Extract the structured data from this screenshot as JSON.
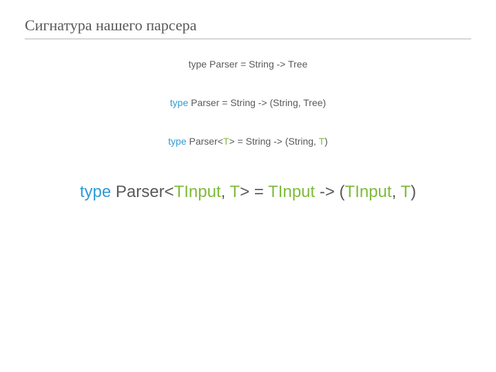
{
  "title": "Сигнатура нашего парсера",
  "line1": {
    "text": "type Parser = String -> Tree"
  },
  "line2": {
    "kw": "type",
    "rest": " Parser = String -> (String, Tree)"
  },
  "line3": {
    "kw": "type",
    "p1": " Parser<",
    "tp1": "T",
    "p2": "> = String -> (String, ",
    "tp2": "T",
    "p3": ")"
  },
  "line4": {
    "kw": "type",
    "p1": " Parser<",
    "tp1": "TInput",
    "c1": ", ",
    "tp2": "T",
    "p2": "> = ",
    "tp3": "TInput",
    "p3": " -> (",
    "tp4": "TInput",
    "c2": ", ",
    "tp5": "T",
    "p4": ")"
  }
}
